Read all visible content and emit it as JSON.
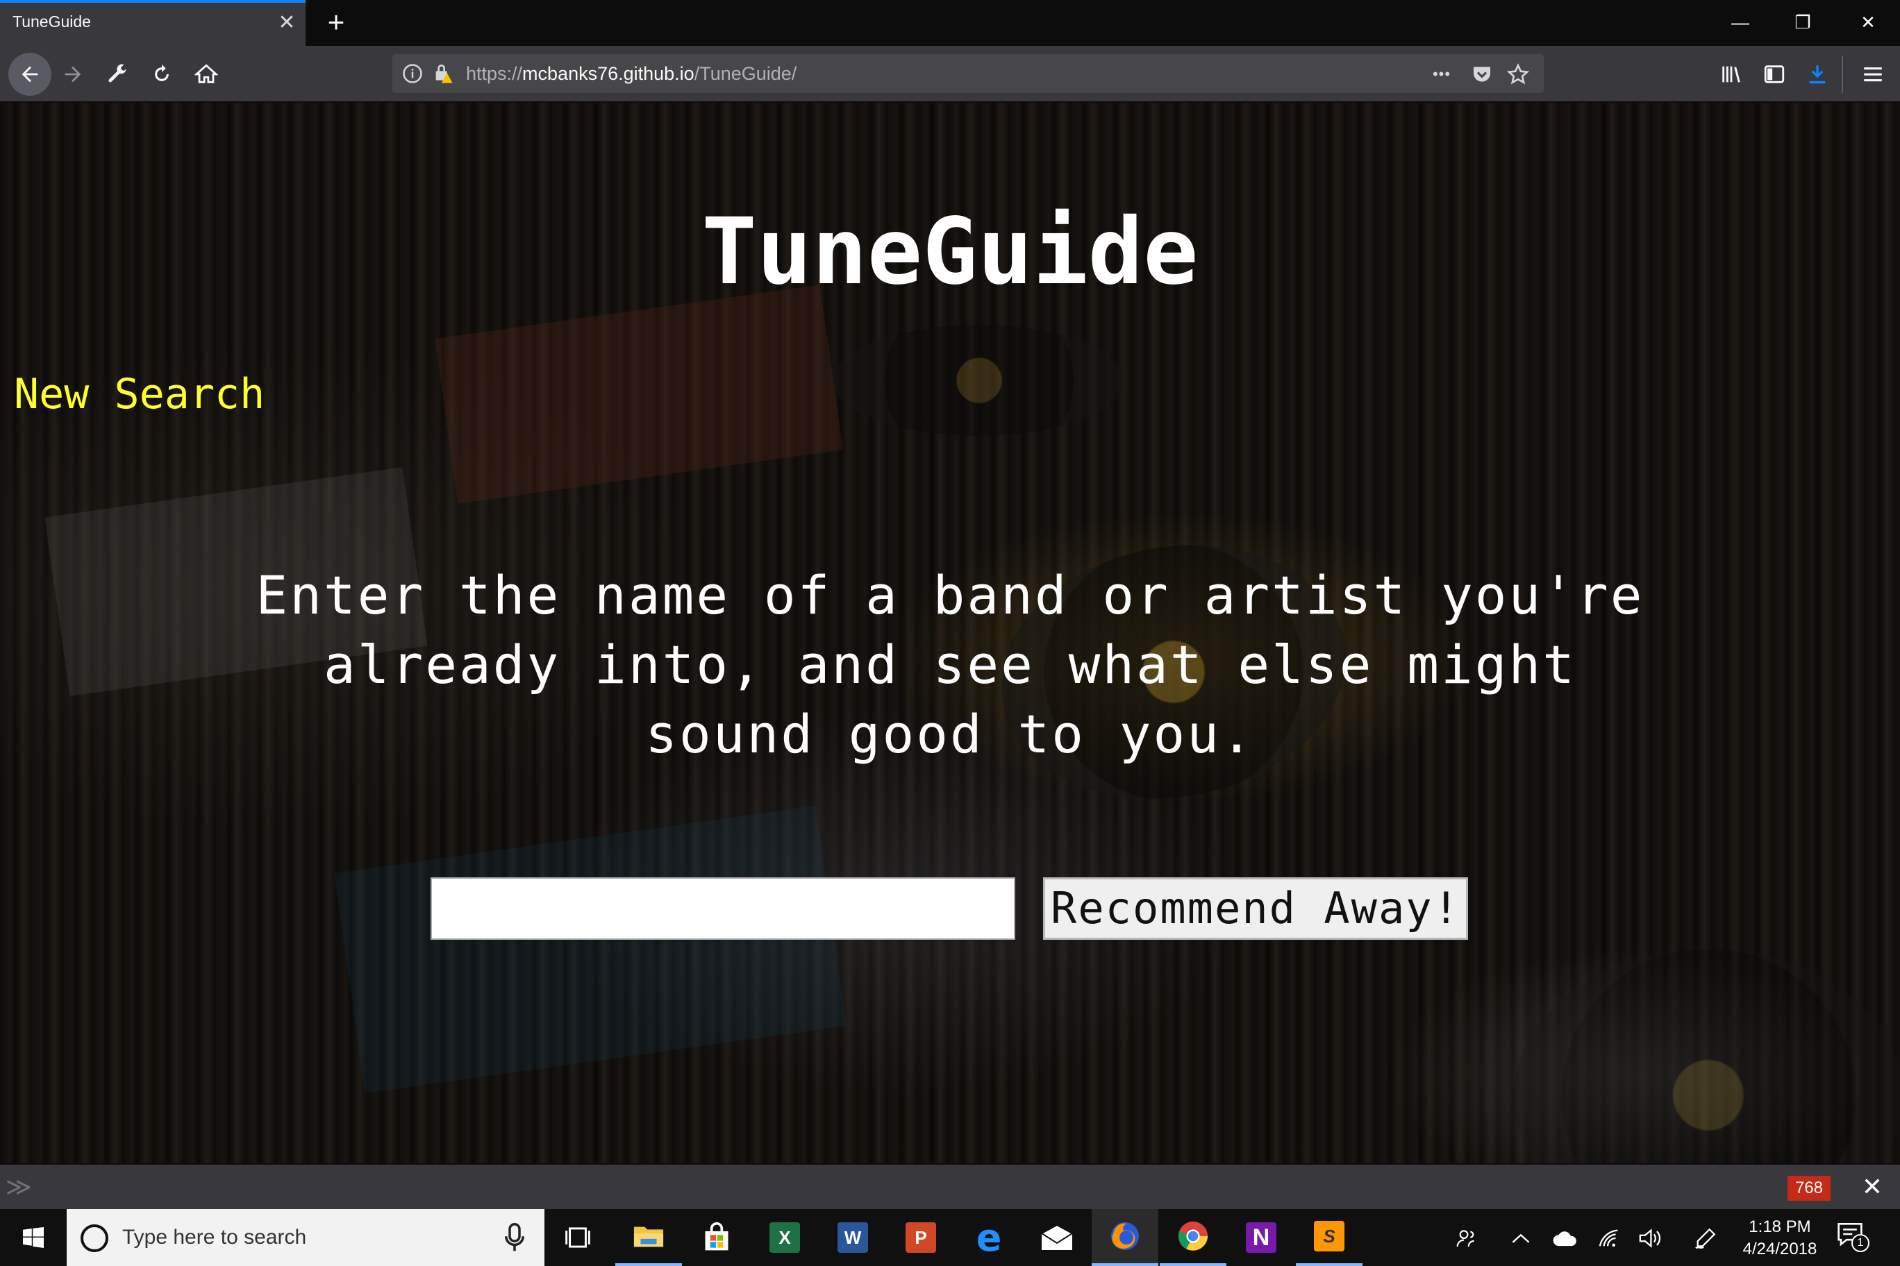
{
  "browser": {
    "tab_title": "TuneGuide",
    "tab_close_glyph": "✕",
    "new_tab_glyph": "+",
    "window_controls": {
      "minimize": "—",
      "restore": "❐",
      "close": "✕"
    },
    "url_prefix": "https://",
    "url_host": "mcbanks76.github.io",
    "url_path": "/TuneGuide/",
    "page_actions_glyph": "•••",
    "icons": [
      "back-icon",
      "forward-icon",
      "wrench-icon",
      "reload-icon",
      "home-icon",
      "info-icon",
      "insecure-lock-icon",
      "pocket-icon",
      "bookmark-star-icon",
      "library-icon",
      "sidebar-icon",
      "download-icon",
      "menu-icon"
    ]
  },
  "page": {
    "title": "TuneGuide",
    "new_search_link": "New Search",
    "intro_text": "Enter the name of a band or artist you're already into, and see what else might sound good to you.",
    "search_input_value": "",
    "recommend_button": "Recommend Away!",
    "colors": {
      "title": "#ffffff",
      "link": "#ffff2e",
      "intro": "#ffffff",
      "button_bg": "#efefef"
    }
  },
  "devbar": {
    "chevron": "≫",
    "badge": "768",
    "close_glyph": "✕"
  },
  "taskbar": {
    "search_placeholder": "Type here to search",
    "apps": [
      {
        "name": "Task View",
        "icon": "task-view-icon"
      },
      {
        "name": "File Explorer",
        "icon": "folder-icon"
      },
      {
        "name": "Microsoft Store",
        "icon": "store-icon"
      },
      {
        "name": "Excel",
        "icon": "excel-icon",
        "letter": "X"
      },
      {
        "name": "Word",
        "icon": "word-icon",
        "letter": "W"
      },
      {
        "name": "PowerPoint",
        "icon": "powerpoint-icon",
        "letter": "P"
      },
      {
        "name": "Edge",
        "icon": "edge-icon",
        "letter": "e"
      },
      {
        "name": "Mail",
        "icon": "mail-icon"
      },
      {
        "name": "Firefox",
        "icon": "firefox-icon"
      },
      {
        "name": "Chrome",
        "icon": "chrome-icon"
      },
      {
        "name": "OneNote",
        "icon": "onenote-icon",
        "letter": "N"
      },
      {
        "name": "Sublime Text",
        "icon": "sublime-icon",
        "letter": "S"
      }
    ],
    "time": "1:18 PM",
    "date": "4/24/2018",
    "notification_count": "1"
  }
}
